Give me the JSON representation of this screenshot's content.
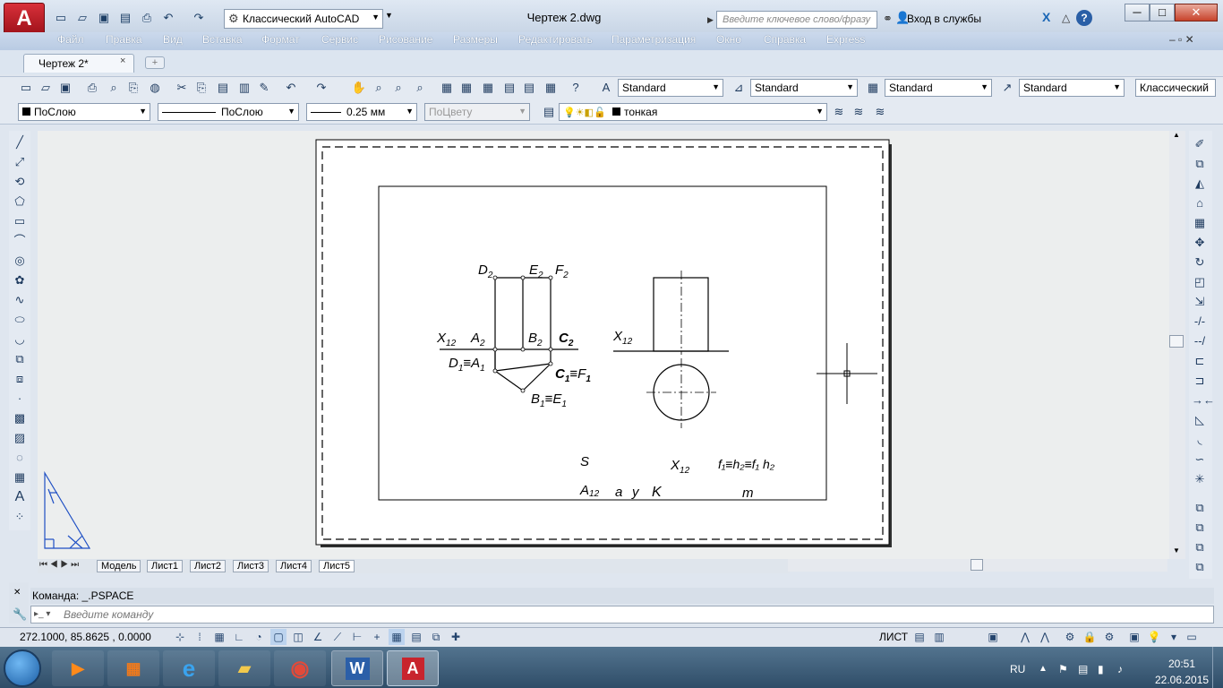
{
  "app": {
    "logo": "A",
    "workspace": "Классический AutoCAD",
    "doc_title": "Чертеж 2.dwg",
    "search_placeholder": "Введите ключевое слово/фразу",
    "signin": "Вход в службы",
    "help": "?"
  },
  "menu": [
    "Файл",
    "Правка",
    "Вид",
    "Вставка",
    "Формат",
    "Сервис",
    "Рисование",
    "Размеры",
    "Редактировать",
    "Параметризация",
    "Окно",
    "Справка",
    "Express"
  ],
  "tabs": {
    "active": "Чертеж 2*",
    "close": "×",
    "new": "+"
  },
  "toolbar1": {
    "text_style": "Standard",
    "dim_style": "Standard",
    "table_style": "Standard",
    "mleader_style": "Standard",
    "workspace": "Классический"
  },
  "toolbar2": {
    "color": "ПоСлою",
    "linetype": "ПоСлою",
    "lineweight": "0.25 мм",
    "plotstyle": "ПоЦвету",
    "layer": "тонкая"
  },
  "layout_tabs": [
    "Модель",
    "Лист1",
    "Лист2",
    "Лист3",
    "Лист4",
    "Лист5"
  ],
  "command": {
    "history": "Команда:  _.PSPACE",
    "placeholder": "Введите команду"
  },
  "status": {
    "coords": "272.1000,  85.8625 , 0.0000",
    "space": "ЛИСТ"
  },
  "taskbar": {
    "lang": "RU",
    "time": "20:51",
    "date": "22.06.2015"
  },
  "drawing": {
    "D2": "D",
    "D2_sub": "2",
    "E2": "E",
    "E2_sub": "2",
    "F2": "F",
    "F2_sub": "2",
    "X12_left": "X",
    "X12_left_sub": "12",
    "A2": "A",
    "A2_sub": "2",
    "B2": "B",
    "B2_sub": "2",
    "C2": "C",
    "C2_sub": "2",
    "D1A1": "D",
    "D1A1_sub1": "1",
    "D1A1_eq": "≡A",
    "D1A1_sub2": "1",
    "C1F1": "C",
    "C1F1_sub1": "1",
    "C1F1_eq": "≡F",
    "C1F1_sub2": "1",
    "B1E1": "B",
    "B1E1_sub1": "1",
    "B1E1_eq": "≡E",
    "B1E1_sub2": "1",
    "X12_right": "X",
    "X12_right_sub": "12",
    "S": "S",
    "X12_bottom": "X",
    "X12_bottom_sub": "12",
    "fh": "f₁≡h₂≡f₁  h₂",
    "A12": "A",
    "A12_sub": "12",
    "a": "a",
    "y": "y",
    "K": "K",
    "m": "m"
  },
  "colors": {
    "menubar": "#b9cbe3",
    "ucs": "#1e4fc4",
    "logo": "#c8242d"
  },
  "icons": [
    "new-icon",
    "open-icon",
    "save-icon",
    "print-icon",
    "undo-icon",
    "redo-icon",
    "pan-icon",
    "zoom-icon",
    "properties-icon",
    "line-icon",
    "circle-icon",
    "text-icon"
  ]
}
